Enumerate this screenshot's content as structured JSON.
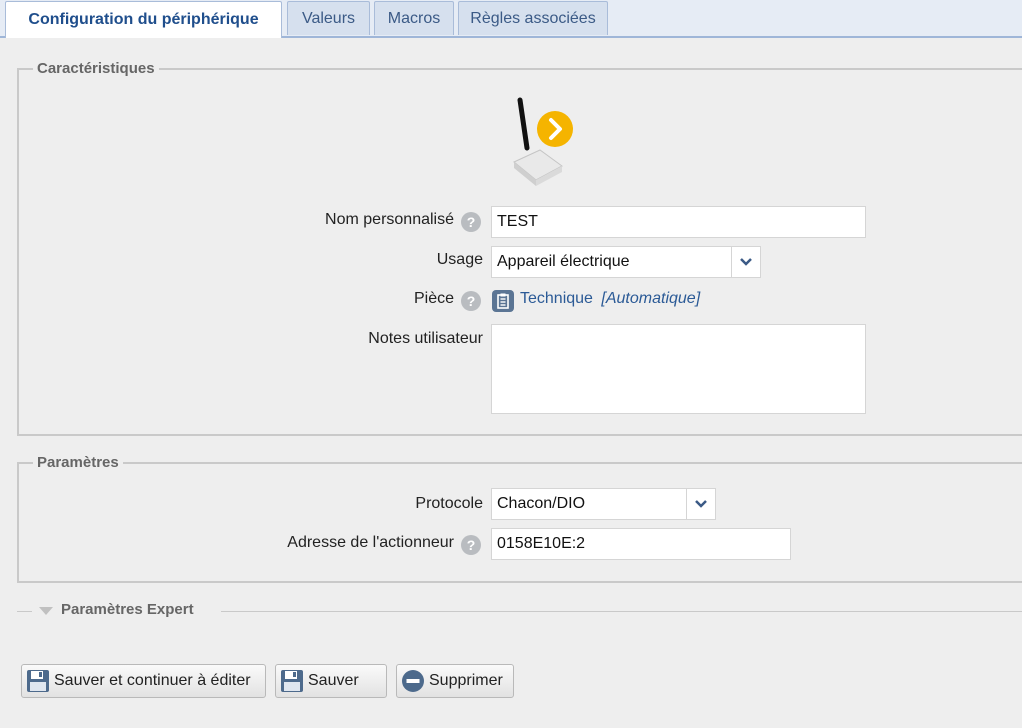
{
  "tabs": [
    {
      "label": "Configuration du périphérique",
      "active": true
    },
    {
      "label": "Valeurs",
      "active": false
    },
    {
      "label": "Macros",
      "active": false
    },
    {
      "label": "Règles associées",
      "active": false
    }
  ],
  "caracteristiques": {
    "legend": "Caractéristiques",
    "device_icon": "rf-transmitter-with-arrow-icon",
    "nom": {
      "label": "Nom personnalisé",
      "value": "TEST"
    },
    "usage": {
      "label": "Usage",
      "value": "Appareil électrique"
    },
    "piece": {
      "label": "Pièce",
      "value": "Technique",
      "suffix": "[Automatique]"
    },
    "notes": {
      "label": "Notes utilisateur",
      "value": ""
    }
  },
  "parametres": {
    "legend": "Paramètres",
    "protocole": {
      "label": "Protocole",
      "value": "Chacon/DIO"
    },
    "adresse": {
      "label": "Adresse de l'actionneur",
      "value": "0158E10E:2"
    }
  },
  "expert": {
    "label": "Paramètres Expert"
  },
  "buttons": {
    "save_continue": "Sauver et continuer à éditer",
    "save": "Sauver",
    "delete": "Supprimer"
  },
  "colors": {
    "accent": "#1f4e8c",
    "link": "#2b5a96",
    "arrow_badge": "#f5b400"
  }
}
